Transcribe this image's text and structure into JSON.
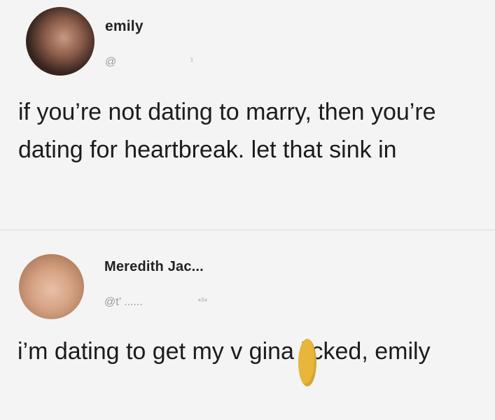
{
  "posts": [
    {
      "author_name": "emily",
      "handle": "@",
      "handle_extra": "¹",
      "text": "if you’re not dating to marry, then you’re dating for heartbreak. let that sink in"
    },
    {
      "author_name": "Meredith Jac...",
      "handle": "@t’ ......",
      "handle_extra": "⁴³⁴",
      "text": "i’m dating to get my v  gina licked, emily"
    }
  ],
  "colors": {
    "background": "#f4f4f4",
    "text": "#1c1c1c",
    "handle": "#9a9a9a",
    "censor": "#e7b63a"
  }
}
